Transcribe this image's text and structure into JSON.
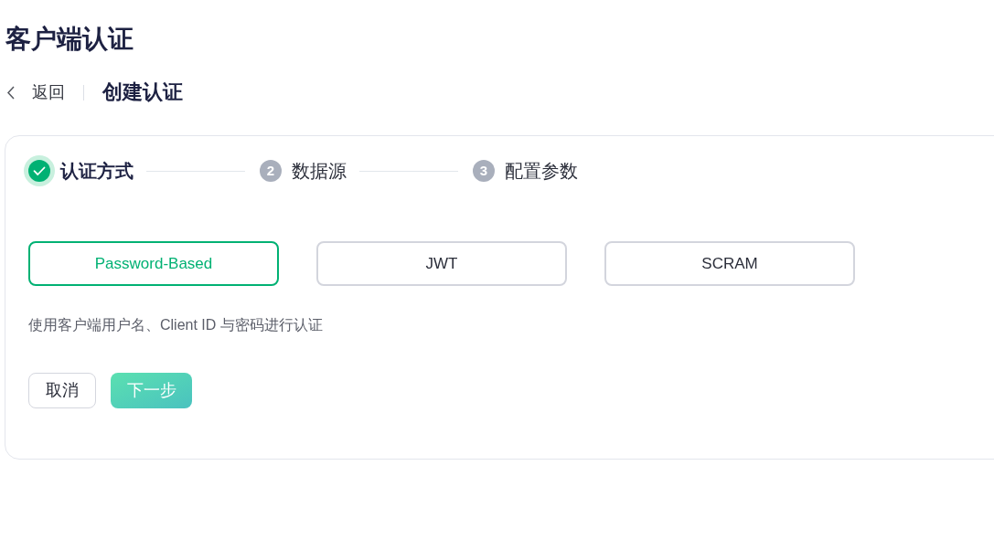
{
  "page_title": "客户端认证",
  "breadcrumb": {
    "back": "返回",
    "current": "创建认证"
  },
  "steps": [
    {
      "label": "认证方式",
      "finished": true
    },
    {
      "number": "2",
      "label": "数据源",
      "finished": false
    },
    {
      "number": "3",
      "label": "配置参数",
      "finished": false
    }
  ],
  "auth_options": [
    {
      "label": "Password-Based",
      "selected": true
    },
    {
      "label": "JWT",
      "selected": false
    },
    {
      "label": "SCRAM",
      "selected": false
    }
  ],
  "description": "使用客户端用户名、Client ID 与密码进行认证",
  "buttons": [
    {
      "label": "取消",
      "kind": "secondary"
    },
    {
      "label": "下一步",
      "kind": "primary"
    }
  ]
}
